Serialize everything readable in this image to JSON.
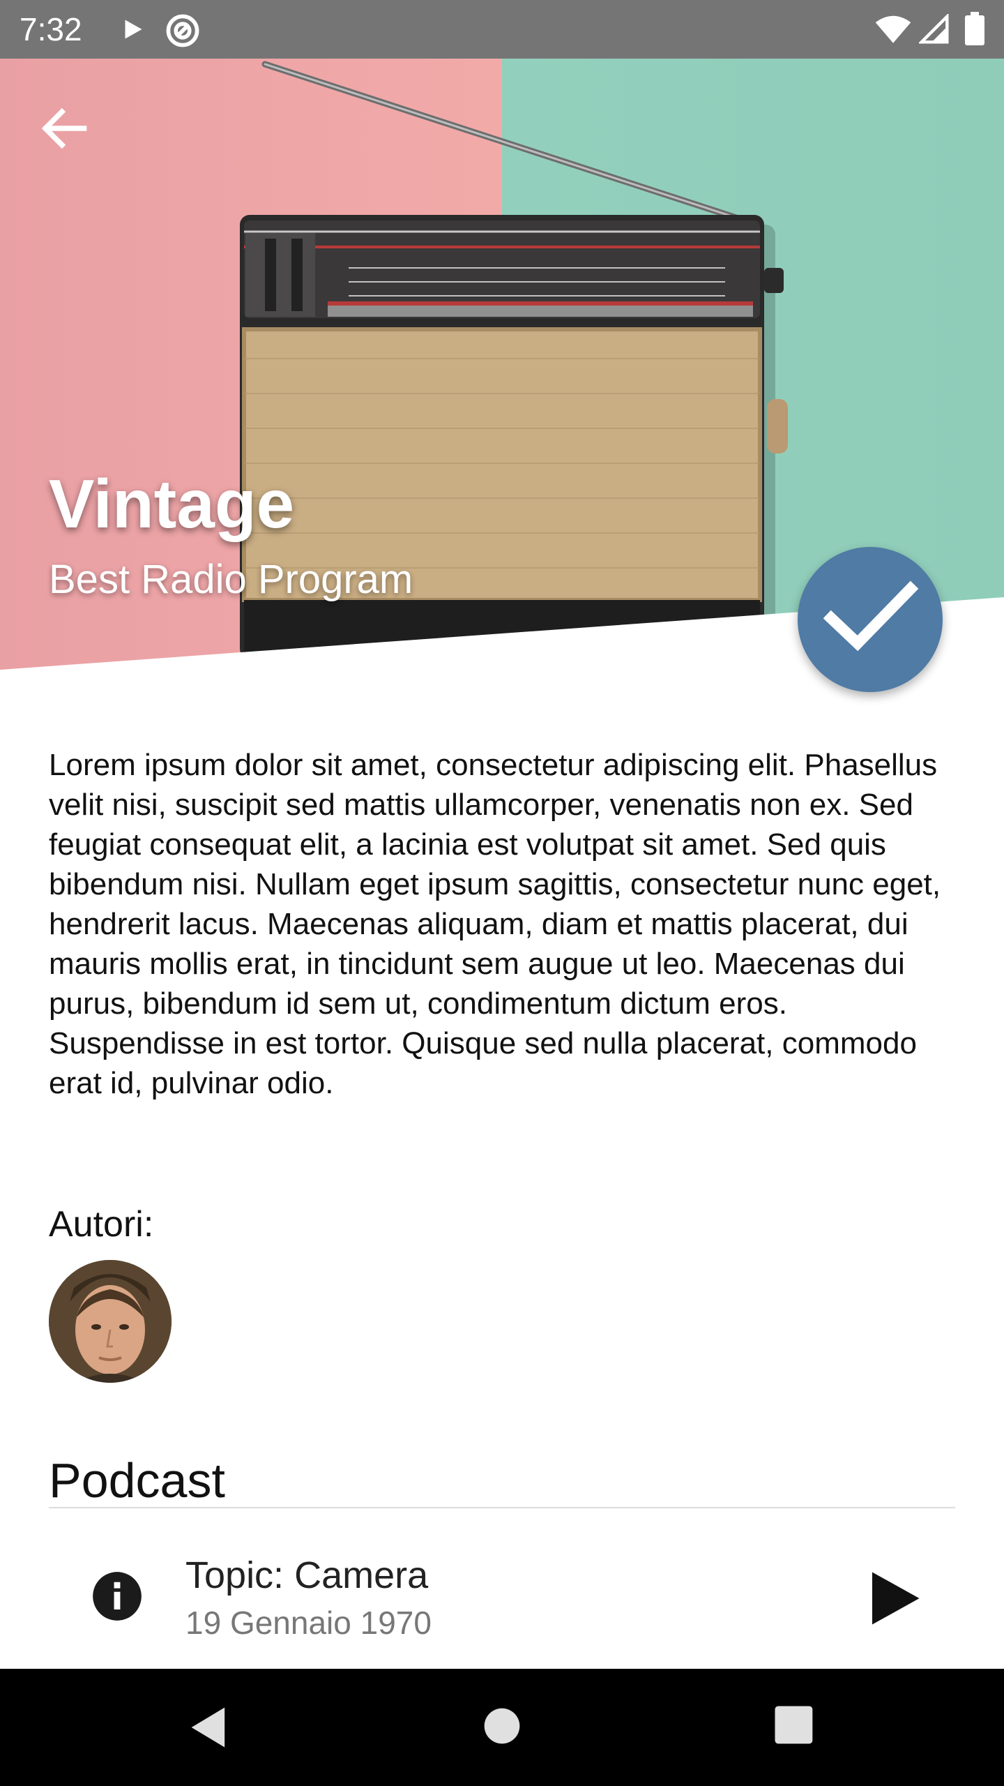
{
  "status_bar": {
    "time": "7:32",
    "icons": [
      "play-icon",
      "sync-icon",
      "wifi-icon",
      "signal-icon",
      "battery-icon"
    ]
  },
  "header": {
    "title": "Vintage",
    "subtitle": "Best Radio Program",
    "back_icon": "arrow-left-icon",
    "fab_icon": "check-icon"
  },
  "description": " Lorem ipsum dolor sit amet, consectetur adipiscing elit. Phasellus velit nisi, suscipit sed mattis ullamcorper, venenatis non ex. Sed feugiat consequat elit, a lacinia est volutpat sit amet. Sed quis bibendum nisi. Nullam eget ipsum sagittis, consectetur nunc eget, hendrerit lacus. Maecenas aliquam, diam et mattis placerat, dui mauris mollis erat, in tincidunt sem augue ut leo. Maecenas dui purus, bibendum id sem ut, condimentum dictum eros. Suspendisse in est tortor. Quisque sed nulla placerat, commodo erat id, pulvinar odio.",
  "authors": {
    "label": "Autori:"
  },
  "podcast": {
    "heading": "Podcast",
    "items": [
      {
        "topic": "Topic: Camera",
        "date": "19 Gennaio 1970",
        "info_icon": "info-icon",
        "action_icon": "play-icon"
      }
    ]
  },
  "navigation": {
    "icons": [
      "triangle-back-icon",
      "circle-home-icon",
      "square-recents-icon"
    ]
  },
  "colors": {
    "status_bar": "#757575",
    "accent": "#4f7ba5",
    "hero_pink": "#f2aaa9",
    "hero_teal": "#8fcdb9",
    "nav_bar": "#000000"
  }
}
